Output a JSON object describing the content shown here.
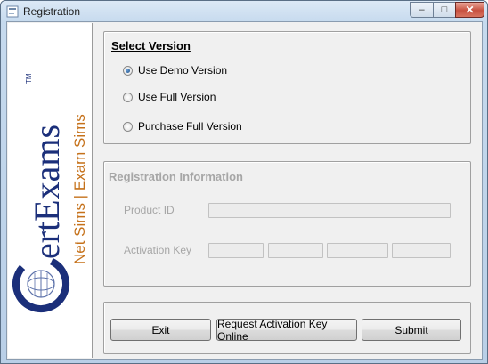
{
  "window": {
    "title": "Registration",
    "controls": {
      "minimize": "–",
      "maximize": "□",
      "close": "✕"
    }
  },
  "logo": {
    "brand_c": "C",
    "brand_rest": "ertExams",
    "trademark": "TM",
    "tagline": "Net Sims | Exam Sims",
    "colors": {
      "brand": "#1b2f7a",
      "tagline": "#c5711a"
    }
  },
  "select_version": {
    "title": "Select Version",
    "options": [
      {
        "label": "Use Demo Version",
        "checked": true
      },
      {
        "label": "Use Full Version",
        "checked": false
      },
      {
        "label": "Purchase Full Version",
        "checked": false
      }
    ]
  },
  "registration_info": {
    "title": "Registration Information",
    "product_id_label": "Product ID",
    "product_id_value": "",
    "activation_key_label": "Activation Key",
    "activation_key_parts": [
      "",
      "",
      "",
      ""
    ]
  },
  "buttons": {
    "exit": "Exit",
    "request": "Request Activation Key Online",
    "submit": "Submit"
  }
}
